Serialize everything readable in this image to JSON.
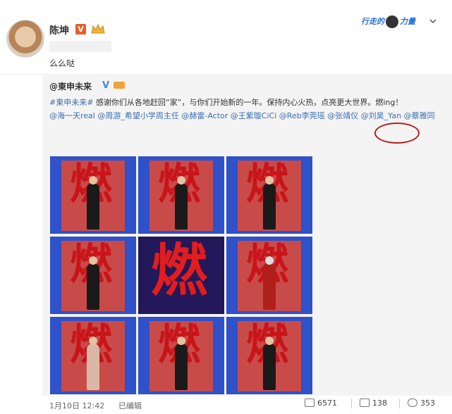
{
  "header": {
    "username": "陈坤",
    "v_badge": "V",
    "status_text": "么么哒",
    "power_badge_left": "行走的",
    "power_badge_right": "力量"
  },
  "repost": {
    "author": "@東申未来",
    "v_mark": "V",
    "text_hashtag": "#東申未来#",
    "text_body": "感谢你们从各地赶回“家”，与你们开始新的一年。保持内心火热，点亮更大世界。燃ing！",
    "mentions": [
      "@海一天real",
      "@周游_希望小学周主任",
      "@赫雷-Actor",
      "@王紫璇CiCi",
      "@Reb李莞瑶",
      "@张靖仪",
      "@刘昊_Yan",
      "@蔡雅同"
    ],
    "photo_glyph": "燃"
  },
  "footer": {
    "date": "1月10日 12:42",
    "edited": "已编辑",
    "reposts": "6571",
    "comments": "138",
    "likes": "353"
  },
  "colors": {
    "link": "#3a6fb4",
    "orange_v": "#e85c29",
    "blue_v": "#3c8ae8",
    "photo_bg": "#2f51c9",
    "circle": "#c01c1c"
  }
}
